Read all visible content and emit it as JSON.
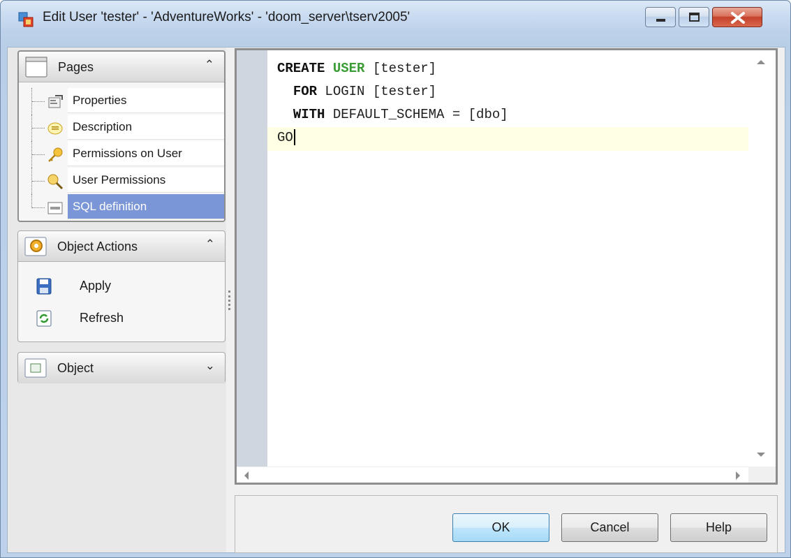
{
  "window": {
    "title": "Edit User 'tester' - 'AdventureWorks' - 'doom_server\\tserv2005'"
  },
  "sidebar": {
    "pages": {
      "header": "Pages",
      "items": [
        {
          "label": "Properties",
          "icon": "properties-icon"
        },
        {
          "label": "Description",
          "icon": "description-icon"
        },
        {
          "label": "Permissions on User",
          "icon": "key-icon"
        },
        {
          "label": "User Permissions",
          "icon": "magnifier-key-icon"
        },
        {
          "label": "SQL definition",
          "icon": "sql-icon",
          "selected": true
        }
      ]
    },
    "object_actions": {
      "header": "Object Actions",
      "items": [
        {
          "label": "Apply",
          "icon": "save-icon"
        },
        {
          "label": "Refresh",
          "icon": "refresh-icon"
        }
      ]
    },
    "object": {
      "header": "Object"
    }
  },
  "editor": {
    "lines": [
      {
        "kw1": "CREATE",
        "kw2": "USER",
        "rest": " [tester]"
      },
      {
        "indent": "  ",
        "kw1": "FOR",
        "rest": " LOGIN [tester]"
      },
      {
        "indent": "  ",
        "kw1": "WITH",
        "rest": " DEFAULT_SCHEMA = [dbo]"
      },
      {
        "rest": "GO"
      }
    ],
    "colors": {
      "keyword_green": "#3a9c35",
      "current_line": "#ffffe3",
      "gutter": "#cfd6e0"
    }
  },
  "buttons": {
    "ok": "OK",
    "cancel": "Cancel",
    "help": "Help"
  }
}
